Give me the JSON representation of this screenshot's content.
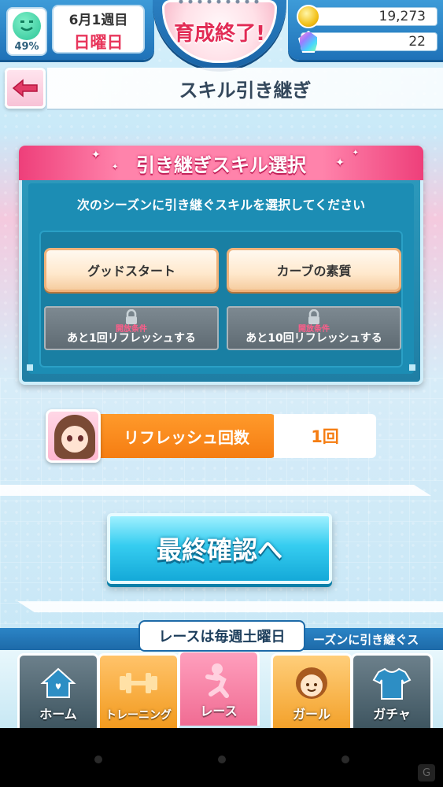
{
  "header": {
    "mood_percent": "49%",
    "date_week": "6月1週目",
    "date_day": "日曜日",
    "finish_label": "育成終了!",
    "coins": "19,273",
    "gems": "22"
  },
  "title_bar": {
    "title": "スキル引き継ぎ"
  },
  "skill_panel": {
    "heading": "引き継ぎスキル選択",
    "instruction": "次のシーズンに引き継ぐスキルを選択してください",
    "skills": [
      {
        "label": "グッドスタート"
      },
      {
        "label": "カーブの素質"
      }
    ],
    "locked": [
      {
        "condition": "開放条件",
        "text": "あと1回リフレッシュする"
      },
      {
        "condition": "開放条件",
        "text": "あと10回リフレッシュする"
      }
    ]
  },
  "refresh": {
    "label": "リフレッシュ回数",
    "value": "1回"
  },
  "confirm": {
    "label": "最終確認へ"
  },
  "ticker": {
    "popup": "レースは毎週土曜日",
    "scroll_text": "ーズンに引き継ぐス"
  },
  "nav": {
    "items": [
      {
        "label": "ホーム",
        "icon": "home-icon",
        "color": "#3e5560"
      },
      {
        "label": "トレーニング",
        "icon": "dumbbell-icon",
        "color": "#f29a1e"
      },
      {
        "label": "レース",
        "icon": "runner-icon",
        "color": "#f06c93"
      },
      {
        "label": "ガール",
        "icon": "girl-icon",
        "color": "#f3a12a"
      },
      {
        "label": "ガチャ",
        "icon": "shirt-icon",
        "color": "#3e5560"
      }
    ]
  },
  "colors": {
    "accent_pink": "#e22b55",
    "accent_blue": "#1f72b8",
    "accent_orange": "#f57d12",
    "confirm_cyan": "#36cdf0"
  }
}
